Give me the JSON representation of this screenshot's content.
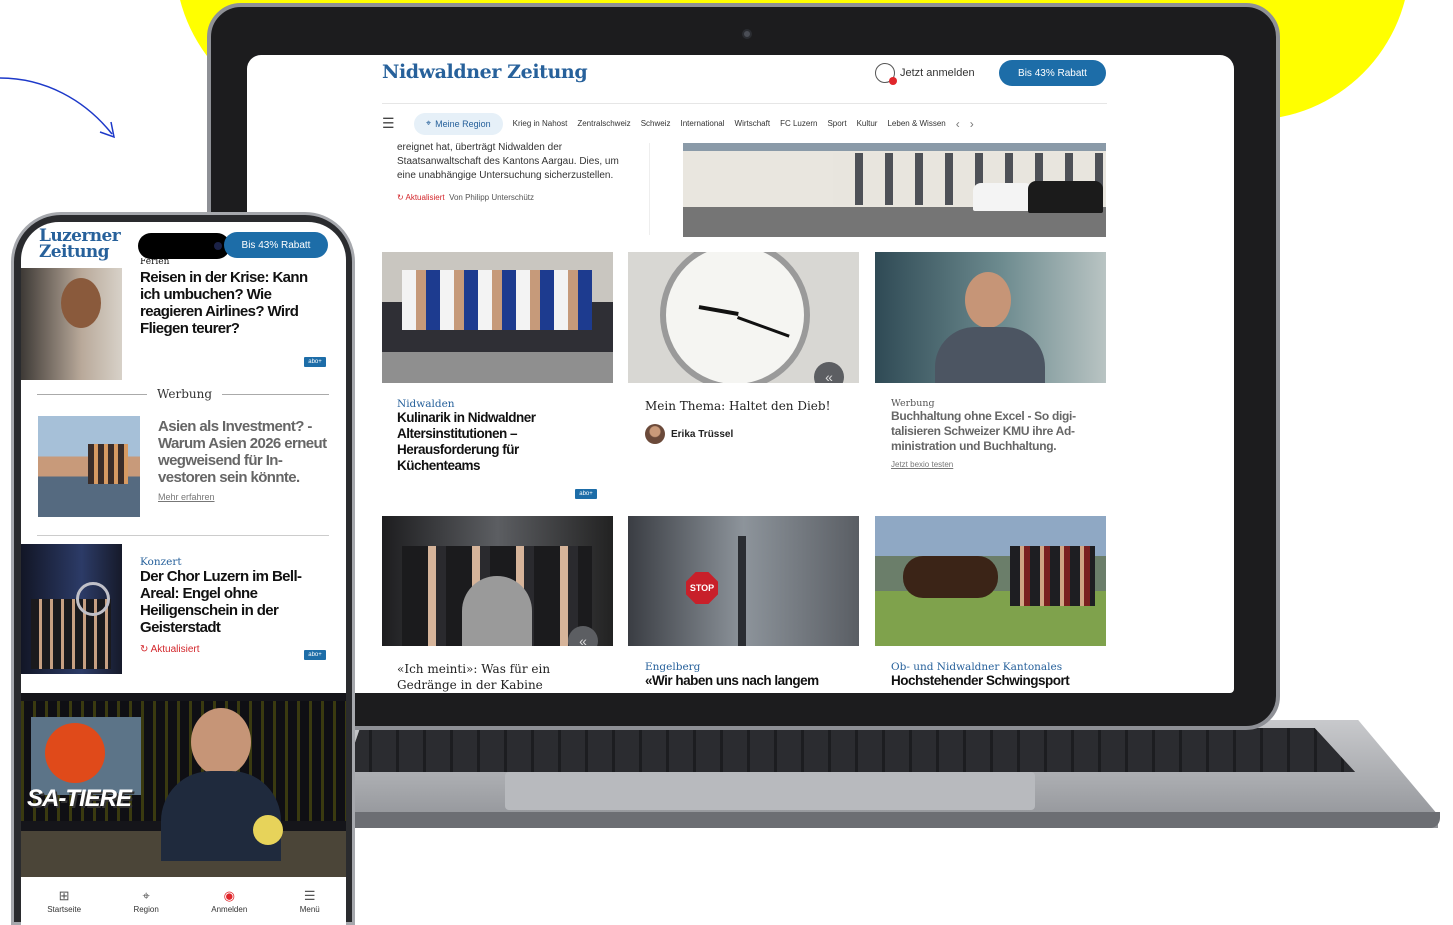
{
  "laptop": {
    "brand": "Nidwaldner Zeitung",
    "login_label": "Jetzt anmelden",
    "promo_button": "Bis 43% Rabatt",
    "nav": {
      "menu_icon": "menu-search-icon",
      "region_pill": "Meine Region",
      "items": [
        "Krieg in Nahost",
        "Zentralschweiz",
        "Schweiz",
        "International",
        "Wirtschaft",
        "FC Luzern",
        "Sport",
        "Kultur",
        "Leben & Wissen"
      ],
      "prev": "‹",
      "next": "›"
    },
    "lead": {
      "text": "ereignet hat, überträgt Nidwalden der Staatsanwaltschaft des Kantons Aargau. Dies, um eine unabhängige Untersuchung sicherzustellen.",
      "status": "Aktualisiert",
      "byline": "Von Philipp Unterschütz"
    },
    "tiles": [
      {
        "kicker": "Nidwalden",
        "headline": "Kulinarik in Nidwaldner Altersinstitutionen – Herausforderung für Küchenteams",
        "badge": "abo+"
      },
      {
        "headline": "Mein Thema: Haltet den Dieb!",
        "author": "Erika Trüssel"
      },
      {
        "kicker": "Werbung",
        "headline": "Buchhaltung ohne Excel - So digi­talisieren Schweizer KMU ihre Ad­ministration und Buchhaltung.",
        "link": "Jetzt bexio testen"
      },
      {
        "headline": "«Ich meinti»: Was für ein Gedränge in der Kabine"
      },
      {
        "kicker": "Engelberg",
        "headline": "«Wir haben uns nach langem"
      },
      {
        "kicker": "Ob- und Nidwaldner Kantonales",
        "headline": "Hochstehender Schwingsport"
      }
    ],
    "stop_sign": "STOP"
  },
  "phone": {
    "logo_line1": "Luzerner",
    "logo_line2": "Zeitung",
    "promo_button": "Bis 43% Rabatt",
    "article1": {
      "kicker": "Ferien",
      "headline": "Reisen in der Krise: Kann ich umbuchen? Wie reagieren Airlines? Wird Fliegen teurer?",
      "badge": "abo+"
    },
    "ad": {
      "label": "Werbung",
      "headline": "Asien als Investment? - Warum Asien 2026 er­neut wegweisend für In­vestoren sein könnte.",
      "link": "Mehr erfahren"
    },
    "article2": {
      "kicker": "Konzert",
      "headline": "Der Chor Luzern im Bell-Areal: Engel ohne Heiligenschein in der Geisterstadt",
      "status": "Aktualisiert",
      "badge": "abo+"
    },
    "video_caption": "SA-TIERE",
    "bottom_nav": [
      {
        "icon": "home-icon",
        "label": "Startseite"
      },
      {
        "icon": "location-pin-icon",
        "label": "Region"
      },
      {
        "icon": "user-icon",
        "label": "Anmelden"
      },
      {
        "icon": "menu-icon",
        "label": "Menü"
      }
    ]
  },
  "colors": {
    "brand_blue": "#27619b",
    "button_blue": "#1d6da8",
    "alert_red": "#d3262b",
    "yellow": "#ffff00"
  }
}
